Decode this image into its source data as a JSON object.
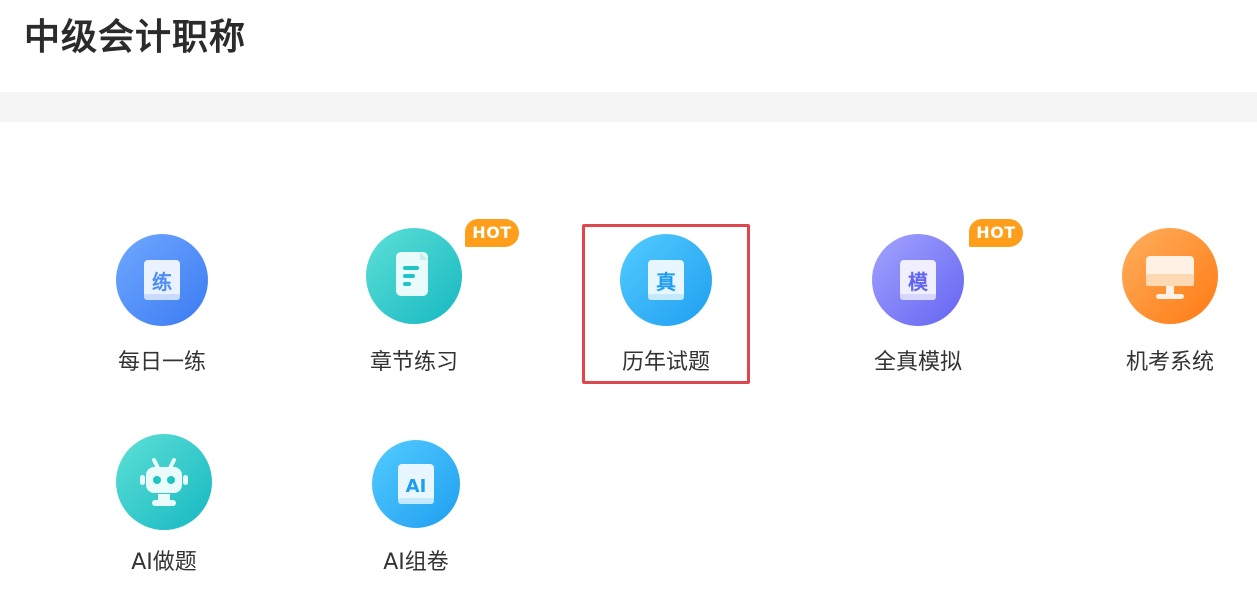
{
  "header": {
    "title": "中级会计职称"
  },
  "badge": {
    "hot": "HOT",
    "color": "#FF9E1B"
  },
  "selection": {
    "highlight_color": "#E0474C",
    "selected_tile": "历年试题"
  },
  "tiles": [
    {
      "label": "每日一练",
      "icon": "daily-practice-icon",
      "icon_glyph": "练",
      "hot": false,
      "color": "#4E8DF7"
    },
    {
      "label": "章节练习",
      "icon": "chapter-practice-icon",
      "icon_glyph": "",
      "hot": true,
      "color": "#1EC6C6"
    },
    {
      "label": "历年试题",
      "icon": "past-exams-icon",
      "icon_glyph": "真",
      "hot": false,
      "color": "#29B6F6"
    },
    {
      "label": "全真模拟",
      "icon": "mock-exam-icon",
      "icon_glyph": "模",
      "hot": true,
      "color": "#7B7BFF"
    },
    {
      "label": "机考系统",
      "icon": "computer-exam-icon",
      "icon_glyph": "",
      "hot": false,
      "color": "#FF8A2A"
    },
    {
      "label": "AI做题",
      "icon": "ai-robot-icon",
      "icon_glyph": "",
      "hot": false,
      "color": "#1EC6C6"
    },
    {
      "label": "AI组卷",
      "icon": "ai-paper-icon",
      "icon_glyph": "AI",
      "hot": false,
      "color": "#29B6F6"
    }
  ]
}
